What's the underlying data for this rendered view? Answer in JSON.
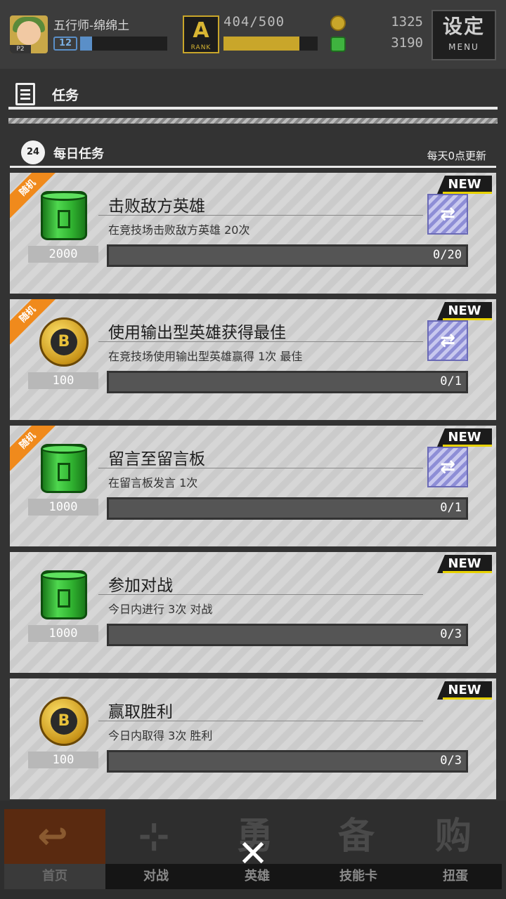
{
  "player": {
    "name": "五行师-绵绵土",
    "level": "12",
    "avatar_tag": "P2"
  },
  "rank": {
    "label": "RANK",
    "letter": "A",
    "progress_text": "404/500",
    "progress": 0.808
  },
  "currency": {
    "coins": "1325",
    "gems": "3190"
  },
  "menu": {
    "label": "设定",
    "sub": "MENU"
  },
  "panel": {
    "title": "任务"
  },
  "daily": {
    "badge": "24",
    "title": "每日任务",
    "refresh_note": "每天0点更新"
  },
  "tasks": [
    {
      "name": "击败敌方英雄",
      "desc": "在竞技场击败敌方英雄  20次",
      "reward_type": "gem-can",
      "reward": "2000",
      "progress": "0/20",
      "random_label": "随机",
      "new_label": "NEW",
      "swap": true
    },
    {
      "name": "使用输出型英雄获得最佳",
      "desc": "在竞技场使用输出型英雄赢得  1次  最佳",
      "reward_type": "gold-coin",
      "reward": "100",
      "progress": "0/1",
      "random_label": "随机",
      "new_label": "NEW",
      "swap": true
    },
    {
      "name": "留言至留言板",
      "desc": "在留言板发言  1次",
      "reward_type": "gem-can",
      "reward": "1000",
      "progress": "0/1",
      "random_label": "随机",
      "new_label": "NEW",
      "swap": true
    },
    {
      "name": "参加对战",
      "desc": "今日内进行  3次  对战",
      "reward_type": "gem-can",
      "reward": "1000",
      "progress": "0/3",
      "new_label": "NEW",
      "swap": false
    },
    {
      "name": "赢取胜利",
      "desc": "今日内取得  3次  胜利",
      "reward_type": "gold-coin",
      "reward": "100",
      "progress": "0/3",
      "new_label": "NEW",
      "swap": false
    }
  ],
  "nav": [
    {
      "label": "首页",
      "glyph": "↩"
    },
    {
      "label": "对战",
      "glyph": "⊹"
    },
    {
      "label": "英雄",
      "glyph": "勇"
    },
    {
      "label": "技能卡",
      "glyph": "备"
    },
    {
      "label": "扭蛋",
      "glyph": "购"
    }
  ],
  "close": {
    "glyph": "✕"
  },
  "colors": {
    "accent_yellow": "#e8d200",
    "ribbon_orange": "#f08a1c",
    "rank_gold": "#c9a62a",
    "exp_blue": "#5a8fc8"
  },
  "icons": {
    "coin": "gold-coin-icon",
    "gem": "green-gem-icon",
    "swap": "swap-icon",
    "close": "close-icon"
  }
}
